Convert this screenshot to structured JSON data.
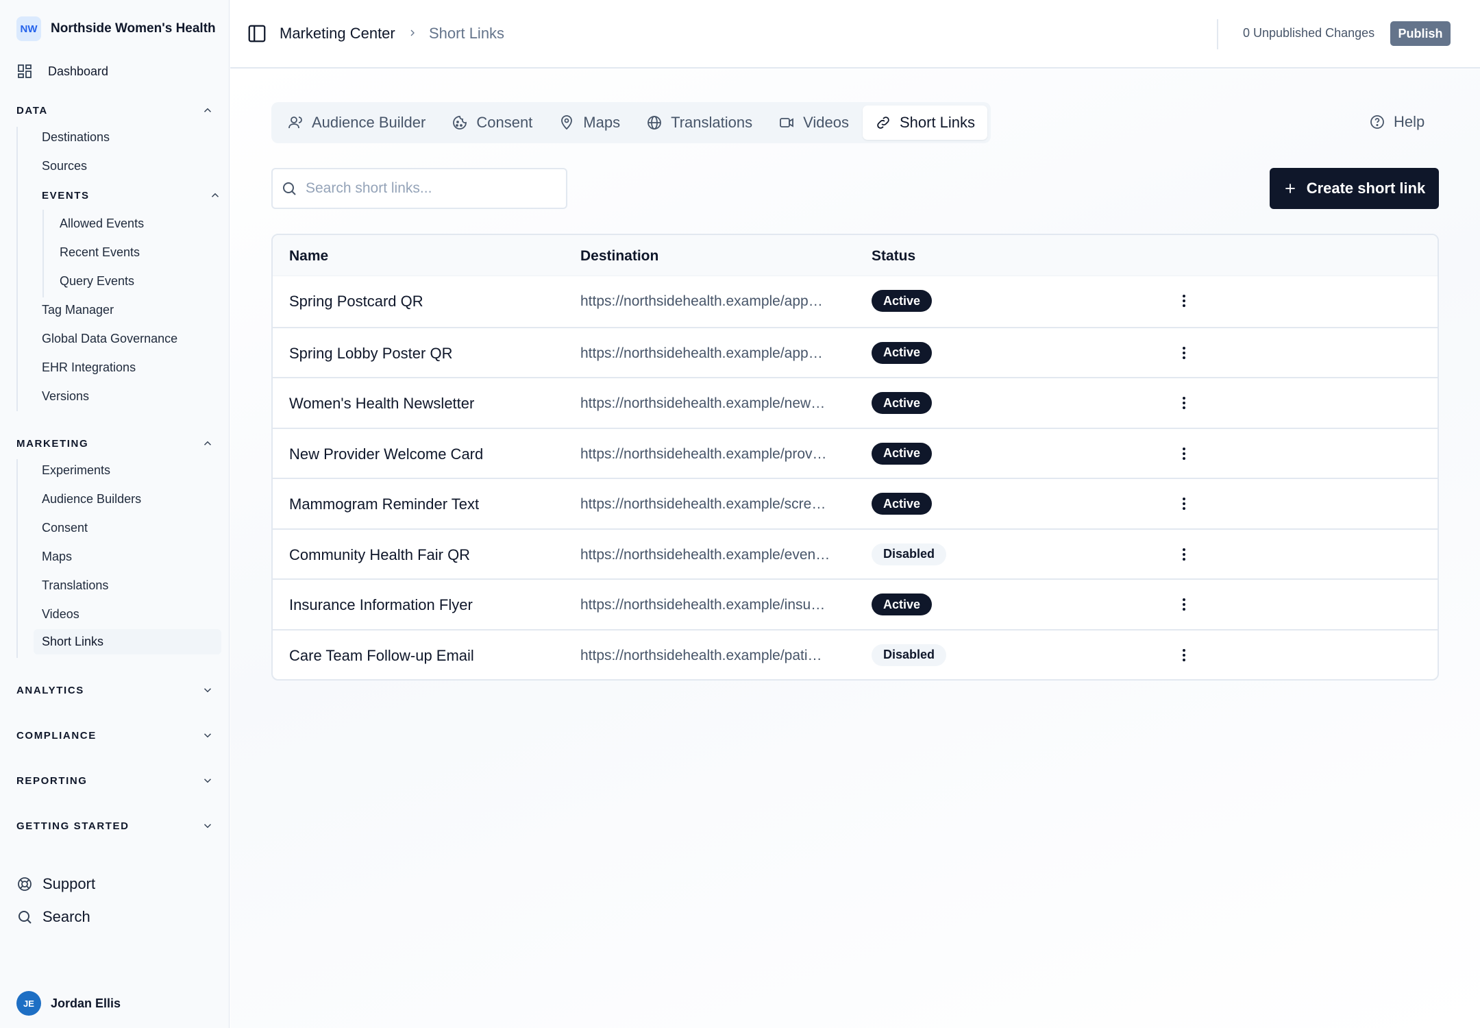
{
  "org": {
    "initials": "NW",
    "name": "Northside Women's Health"
  },
  "sidebar": {
    "dashboard": "Dashboard",
    "data": {
      "heading": "DATA",
      "items": [
        "Destinations",
        "Sources"
      ],
      "events": {
        "heading": "EVENTS",
        "items": [
          "Allowed Events",
          "Recent Events",
          "Query Events"
        ]
      },
      "more": [
        "Tag Manager",
        "Global Data Governance",
        "EHR Integrations",
        "Versions"
      ]
    },
    "marketing": {
      "heading": "MARKETING",
      "items": [
        "Experiments",
        "Audience Builders",
        "Consent",
        "Maps",
        "Translations",
        "Videos",
        "Short Links"
      ]
    },
    "analytics": "ANALYTICS",
    "compliance": "COMPLIANCE",
    "reporting": "REPORTING",
    "getting_started": "GETTING STARTED",
    "support": "Support",
    "search": "Search",
    "user": {
      "initials": "JE",
      "name": "Jordan Ellis"
    }
  },
  "header": {
    "breadcrumb_root": "Marketing Center",
    "breadcrumb_current": "Short Links",
    "unpublished": "0 Unpublished Changes",
    "publish": "Publish"
  },
  "tabs": [
    {
      "label": "Audience Builder",
      "icon": "user-icon"
    },
    {
      "label": "Consent",
      "icon": "cookie-icon"
    },
    {
      "label": "Maps",
      "icon": "map-pin-icon"
    },
    {
      "label": "Translations",
      "icon": "globe-icon"
    },
    {
      "label": "Videos",
      "icon": "video-icon"
    },
    {
      "label": "Short Links",
      "icon": "link-icon"
    }
  ],
  "help": "Help",
  "search": {
    "placeholder": "Search short links..."
  },
  "create_button": "Create short link",
  "table": {
    "columns": [
      "Name",
      "Destination",
      "Status"
    ],
    "rows": [
      {
        "name": "Spring Postcard QR",
        "destination": "https://northsidehealth.example/app…",
        "status": "Active"
      },
      {
        "name": "Spring Lobby Poster QR",
        "destination": "https://northsidehealth.example/app…",
        "status": "Active"
      },
      {
        "name": "Women's Health Newsletter",
        "destination": "https://northsidehealth.example/new…",
        "status": "Active"
      },
      {
        "name": "New Provider Welcome Card",
        "destination": "https://northsidehealth.example/prov…",
        "status": "Active"
      },
      {
        "name": "Mammogram Reminder Text",
        "destination": "https://northsidehealth.example/scre…",
        "status": "Active"
      },
      {
        "name": "Community Health Fair QR",
        "destination": "https://northsidehealth.example/even…",
        "status": "Disabled"
      },
      {
        "name": "Insurance Information Flyer",
        "destination": "https://northsidehealth.example/insu…",
        "status": "Active"
      },
      {
        "name": "Care Team Follow-up Email",
        "destination": "https://northsidehealth.example/pati…",
        "status": "Disabled"
      }
    ]
  },
  "colors": {
    "primary": "#0f172a",
    "accent": "#2563eb",
    "muted": "#475569",
    "border": "#e2e8f0",
    "sidebar_bg": "#f8fafc"
  }
}
